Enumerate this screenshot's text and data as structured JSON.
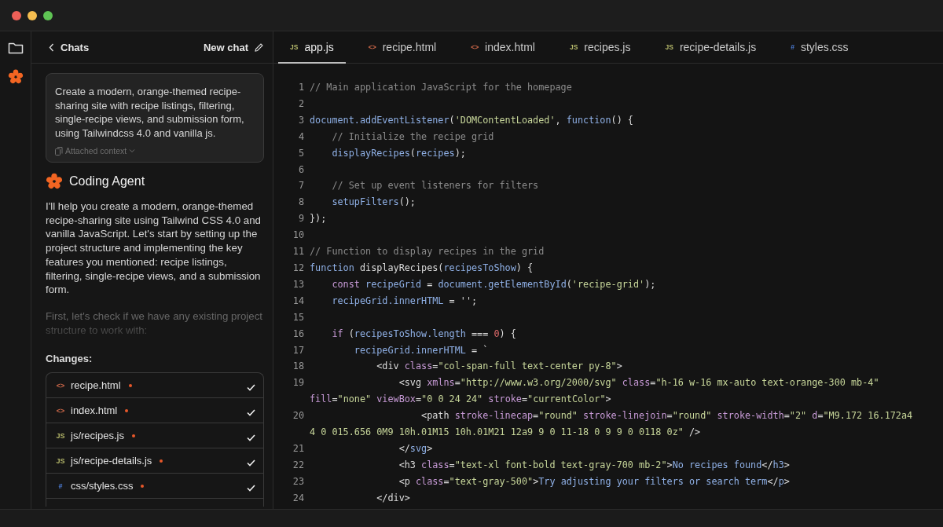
{
  "rail": {
    "items": [
      {
        "kind": "folder",
        "selected": false
      },
      {
        "kind": "agent",
        "selected": true
      }
    ]
  },
  "chat": {
    "back_label": "Chats",
    "new_chat_label": "New chat",
    "prompt": {
      "text": "Create a modern, orange-themed recipe-sharing site with recipe listings, filtering, single-recipe views, and submission form, using Tailwindcss 4.0 and vanilla js.",
      "context_label": "Attached context"
    },
    "agent_name": "Coding Agent",
    "messages": [
      {
        "text": "I'll help you create a modern, orange-themed recipe-sharing site using Tailwind CSS 4.0 and vanilla JavaScript. Let's start by setting up the project structure and implementing the key features you mentioned: recipe listings, filtering, single-recipe views, and a submission form.",
        "faded": false
      },
      {
        "text": "First, let's check if we have any existing project structure to work with:",
        "faded": true
      }
    ],
    "changes_title": "Changes:",
    "changes": [
      {
        "kind": "html",
        "badge": "<>",
        "name": "recipe.html",
        "modified": true,
        "done": true
      },
      {
        "kind": "html",
        "badge": "<>",
        "name": "index.html",
        "modified": true,
        "done": true
      },
      {
        "kind": "js",
        "badge": "JS",
        "name": "js/recipes.js",
        "modified": true,
        "done": true
      },
      {
        "kind": "js",
        "badge": "JS",
        "name": "js/recipe-details.js",
        "modified": true,
        "done": true
      },
      {
        "kind": "css",
        "badge": "#",
        "name": "css/styles.css",
        "modified": true,
        "done": true
      }
    ]
  },
  "tabs": [
    {
      "kind": "js",
      "badge": "JS",
      "label": "app.js",
      "selected": true
    },
    {
      "kind": "html",
      "badge": "<>",
      "label": "recipe.html",
      "selected": false
    },
    {
      "kind": "html",
      "badge": "<>",
      "label": "index.html",
      "selected": false
    },
    {
      "kind": "js",
      "badge": "JS",
      "label": "recipes.js",
      "selected": false
    },
    {
      "kind": "js",
      "badge": "JS",
      "label": "recipe-details.js",
      "selected": false
    },
    {
      "kind": "css",
      "badge": "#",
      "label": "styles.css",
      "selected": false
    }
  ],
  "code": [
    {
      "number": "1",
      "tokens": [
        {
          "kind": "comment",
          "text": "// Main application JavaScript for the homepage"
        }
      ]
    },
    {
      "number": "2"
    },
    {
      "number": "3",
      "tokens": [
        {
          "kind": "name",
          "text": "document.addEventListener"
        },
        {
          "kind": "plain",
          "text": "("
        },
        {
          "kind": "string",
          "text": "'DOMContentLoaded'"
        },
        {
          "kind": "plain",
          "text": ", "
        },
        {
          "kind": "name",
          "text": "function"
        },
        {
          "kind": "plain",
          "text": "() {"
        }
      ]
    },
    {
      "number": "4",
      "tokens": [
        {
          "kind": "comment",
          "text": "    // Initialize the recipe grid"
        }
      ]
    },
    {
      "number": "5",
      "tokens": [
        {
          "kind": "name",
          "text": "    displayRecipes"
        },
        {
          "kind": "plain",
          "text": "("
        },
        {
          "kind": "name",
          "text": "recipes"
        },
        {
          "kind": "plain",
          "text": ");"
        }
      ]
    },
    {
      "number": "6"
    },
    {
      "number": "7",
      "tokens": [
        {
          "kind": "comment",
          "text": "    // Set up event listeners for filters"
        }
      ]
    },
    {
      "number": "8",
      "tokens": [
        {
          "kind": "name",
          "text": "    setupFilters"
        },
        {
          "kind": "plain",
          "text": "();"
        }
      ]
    },
    {
      "number": "9",
      "tokens": [
        {
          "kind": "plain",
          "text": "});"
        }
      ]
    },
    {
      "number": "10"
    },
    {
      "number": "11",
      "tokens": [
        {
          "kind": "comment",
          "text": "// Function to display recipes in the grid"
        }
      ]
    },
    {
      "number": "12",
      "tokens": [
        {
          "kind": "name",
          "text": "function"
        },
        {
          "kind": "plain",
          "text": " displayRecipes("
        },
        {
          "kind": "name",
          "text": "recipesToShow"
        },
        {
          "kind": "plain",
          "text": ") {"
        }
      ]
    },
    {
      "number": "13",
      "tokens": [
        {
          "kind": "keyword",
          "text": "    const"
        },
        {
          "kind": "name",
          "text": " recipeGrid"
        },
        {
          "kind": "plain",
          "text": " = "
        },
        {
          "kind": "name",
          "text": "document.getElementById"
        },
        {
          "kind": "plain",
          "text": "("
        },
        {
          "kind": "string",
          "text": "'recipe-grid'"
        },
        {
          "kind": "plain",
          "text": ");"
        }
      ]
    },
    {
      "number": "14",
      "tokens": [
        {
          "kind": "name",
          "text": "    recipeGrid.innerHTML"
        },
        {
          "kind": "plain",
          "text": " = '';"
        }
      ]
    },
    {
      "number": "15"
    },
    {
      "number": "16",
      "tokens": [
        {
          "kind": "keyword",
          "text": "    if"
        },
        {
          "kind": "plain",
          "text": " ("
        },
        {
          "kind": "name",
          "text": "recipesToShow.length"
        },
        {
          "kind": "plain",
          "text": " === "
        },
        {
          "kind": "number",
          "text": "0"
        },
        {
          "kind": "plain",
          "text": ") {"
        }
      ]
    },
    {
      "number": "17",
      "tokens": [
        {
          "kind": "name",
          "text": "        recipeGrid.innerHTML"
        },
        {
          "kind": "plain",
          "text": " = `"
        }
      ]
    },
    {
      "number": "18",
      "tokens": [
        {
          "kind": "plain",
          "text": "            <div "
        },
        {
          "kind": "keyword",
          "text": "class"
        },
        {
          "kind": "plain",
          "text": "="
        },
        {
          "kind": "string",
          "text": "\"col-span-full text-center py-8\""
        },
        {
          "kind": "plain",
          "text": ">"
        }
      ]
    },
    {
      "number": "19",
      "tokens": [
        {
          "kind": "plain",
          "text": "                <svg "
        },
        {
          "kind": "keyword",
          "text": "xmlns"
        },
        {
          "kind": "plain",
          "text": "="
        },
        {
          "kind": "string",
          "text": "\"http://www.w3.org/2000/svg\""
        },
        {
          "kind": "keyword",
          "text": " class"
        },
        {
          "kind": "plain",
          "text": "="
        },
        {
          "kind": "string",
          "text": "\"h-16 w-16 mx-auto text-orange-300 mb-4\""
        }
      ],
      "wrap": [
        {
          "kind": "keyword",
          "text": "fill"
        },
        {
          "kind": "plain",
          "text": "="
        },
        {
          "kind": "string",
          "text": "\"none\""
        },
        {
          "kind": "keyword",
          "text": " viewBox"
        },
        {
          "kind": "plain",
          "text": "="
        },
        {
          "kind": "string",
          "text": "\"0 0 24 24\""
        },
        {
          "kind": "keyword",
          "text": " stroke"
        },
        {
          "kind": "plain",
          "text": "="
        },
        {
          "kind": "string",
          "text": "\"currentColor\""
        },
        {
          "kind": "plain",
          "text": ">"
        }
      ]
    },
    {
      "number": "20",
      "tokens": [
        {
          "kind": "plain",
          "text": "                    <path "
        },
        {
          "kind": "keyword",
          "text": "stroke-linecap"
        },
        {
          "kind": "plain",
          "text": "="
        },
        {
          "kind": "string",
          "text": "\"round\""
        },
        {
          "kind": "keyword",
          "text": " stroke-linejoin"
        },
        {
          "kind": "plain",
          "text": "="
        },
        {
          "kind": "string",
          "text": "\"round\""
        },
        {
          "kind": "keyword",
          "text": " stroke-width"
        },
        {
          "kind": "plain",
          "text": "="
        },
        {
          "kind": "string",
          "text": "\"2\""
        },
        {
          "kind": "keyword",
          "text": " d"
        },
        {
          "kind": "plain",
          "text": "="
        },
        {
          "kind": "string",
          "text": "\"M9.172 16.172a4"
        }
      ],
      "wrap": [
        {
          "kind": "string",
          "text": "4 0 015.656 0M9 10h.01M15 10h.01M21 12a9 9 0 11-18 0 9 9 0 0118 0z\""
        },
        {
          "kind": "plain",
          "text": " />"
        }
      ]
    },
    {
      "number": "21",
      "tokens": [
        {
          "kind": "plain",
          "text": "                </"
        },
        {
          "kind": "name",
          "text": "svg"
        },
        {
          "kind": "plain",
          "text": ">"
        }
      ]
    },
    {
      "number": "22",
      "tokens": [
        {
          "kind": "plain",
          "text": "                <h3 "
        },
        {
          "kind": "keyword",
          "text": "class"
        },
        {
          "kind": "plain",
          "text": "="
        },
        {
          "kind": "string",
          "text": "\"text-xl font-bold text-gray-700 mb-2\""
        },
        {
          "kind": "plain",
          "text": ">"
        },
        {
          "kind": "name",
          "text": "No recipes found"
        },
        {
          "kind": "plain",
          "text": "</"
        },
        {
          "kind": "name",
          "text": "h3"
        },
        {
          "kind": "plain",
          "text": ">"
        }
      ]
    },
    {
      "number": "23",
      "tokens": [
        {
          "kind": "plain",
          "text": "                <p "
        },
        {
          "kind": "keyword",
          "text": "class"
        },
        {
          "kind": "plain",
          "text": "="
        },
        {
          "kind": "string",
          "text": "\"text-gray-500\""
        },
        {
          "kind": "plain",
          "text": ">"
        },
        {
          "kind": "name",
          "text": "Try adjusting your filters or search term"
        },
        {
          "kind": "plain",
          "text": "</"
        },
        {
          "kind": "name",
          "text": "p"
        },
        {
          "kind": "plain",
          "text": ">"
        }
      ]
    },
    {
      "number": "24",
      "tokens": [
        {
          "kind": "plain",
          "text": "            </div>"
        }
      ]
    }
  ]
}
